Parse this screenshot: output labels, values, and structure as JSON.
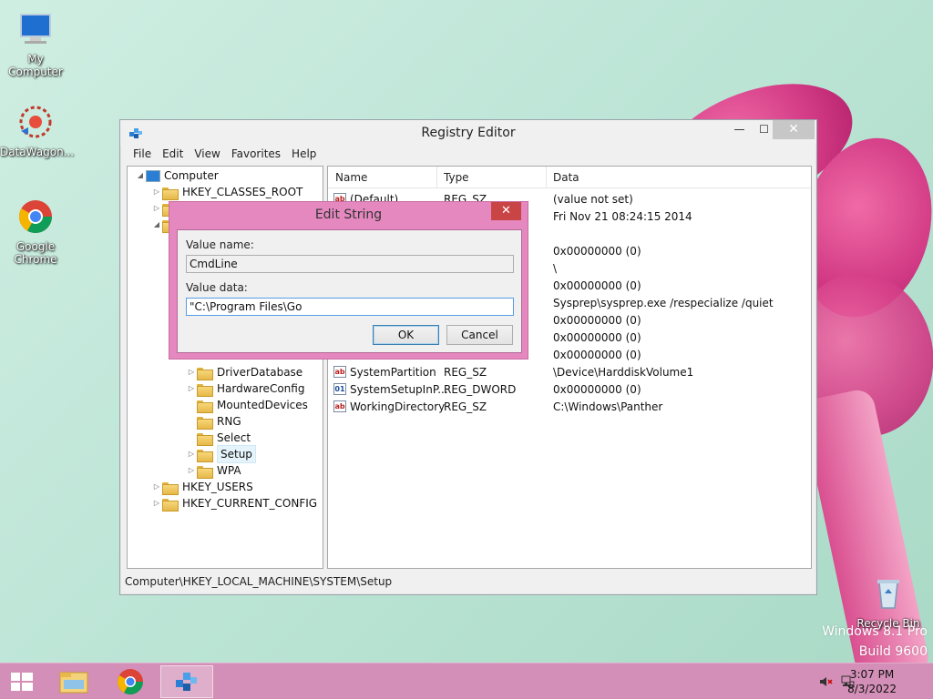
{
  "desktop": {
    "icons": [
      {
        "label": "My Computer"
      },
      {
        "label": "DataWagon..."
      },
      {
        "label": "Google Chrome"
      },
      {
        "label": "Recycle Bin"
      }
    ],
    "watermark": {
      "line1": "Windows 8.1 Pro",
      "line2": "Build 9600"
    }
  },
  "window": {
    "title": "Registry Editor",
    "controls": {
      "minimize": "—",
      "maximize": "☐",
      "close": "✕"
    },
    "menu": [
      "File",
      "Edit",
      "View",
      "Favorites",
      "Help"
    ],
    "tree": {
      "root": "Computer",
      "items": [
        "HKEY_CLASSES_ROOT",
        "DriverDatabase",
        "HardwareConfig",
        "MountedDevices",
        "RNG",
        "Select",
        "Setup",
        "WPA",
        "HKEY_USERS",
        "HKEY_CURRENT_CONFIG"
      ],
      "selected": "Setup"
    },
    "list": {
      "columns": [
        "Name",
        "Type",
        "Data"
      ],
      "rows": [
        {
          "name": "(Default)",
          "type": "REG_SZ",
          "data": "(value not set)",
          "icon": "string-value-icon"
        },
        {
          "name": "",
          "type": "",
          "data": "Fri Nov 21 08:24:15 2014",
          "icon": ""
        },
        {
          "name": "",
          "type": "",
          "data": "0x00000000 (0)",
          "icon": ""
        },
        {
          "name": "",
          "type": "",
          "data": "\\",
          "icon": ""
        },
        {
          "name": "",
          "type": "",
          "data": "0x00000000 (0)",
          "icon": ""
        },
        {
          "name": "",
          "type": "",
          "data": "Sysprep\\sysprep.exe /respecialize /quiet",
          "icon": ""
        },
        {
          "name": "",
          "type": "",
          "data": "0x00000000 (0)",
          "icon": ""
        },
        {
          "name": "",
          "type": "",
          "data": "0x00000000 (0)",
          "icon": ""
        },
        {
          "name": "",
          "type": "",
          "data": "0x00000000 (0)",
          "icon": ""
        },
        {
          "name": "SystemPartition",
          "type": "REG_SZ",
          "data": "\\Device\\HarddiskVolume1",
          "icon": "string-value-icon"
        },
        {
          "name": "SystemSetupInP...",
          "type": "REG_DWORD",
          "data": "0x00000000 (0)",
          "icon": "dword-value-icon"
        },
        {
          "name": "WorkingDirectory",
          "type": "REG_SZ",
          "data": "C:\\Windows\\Panther",
          "icon": "string-value-icon"
        }
      ]
    },
    "status": "Computer\\HKEY_LOCAL_MACHINE\\SYSTEM\\Setup"
  },
  "dialog": {
    "title": "Edit String",
    "close": "✕",
    "value_name_label": "Value name:",
    "value_name": "CmdLine",
    "value_data_label": "Value data:",
    "value_data": "\"C:\\Program Files\\Go",
    "ok": "OK",
    "cancel": "Cancel"
  },
  "taskbar": {
    "time": "3:07 PM",
    "date": "8/3/2022"
  }
}
